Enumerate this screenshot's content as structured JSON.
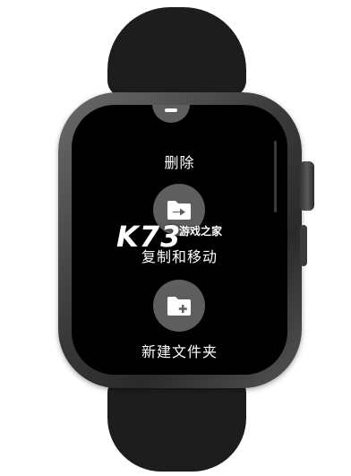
{
  "actions": {
    "delete_label": "删除",
    "copy_move_label": "复制和移动",
    "new_folder_label": "新建文件夹"
  },
  "icons": {
    "delete": "trash-icon",
    "copy_move": "folder-move-icon",
    "new_folder": "folder-plus-icon"
  },
  "watermark": {
    "logo": "K73",
    "text": "游戏之家"
  },
  "colors": {
    "screen_bg": "#000000",
    "button_bg": "#5e5e5e",
    "band": "#1d1d1d",
    "text": "#ffffff"
  }
}
